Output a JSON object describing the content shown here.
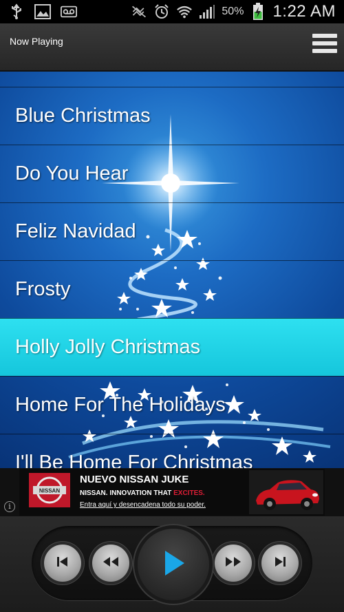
{
  "status_bar": {
    "battery_percent": "50%",
    "time": "1:22 AM",
    "icons": [
      "usb-icon",
      "image-icon",
      "voicemail-icon",
      "mute-icon",
      "alarm-icon",
      "wifi-icon",
      "signal-icon",
      "battery-charging-icon"
    ]
  },
  "header": {
    "title": "Now Playing",
    "menu_icon": "hamburger-menu-icon"
  },
  "songs": [
    {
      "title": "Blue Christmas",
      "selected": false
    },
    {
      "title": "Do You Hear",
      "selected": false
    },
    {
      "title": "Feliz Navidad",
      "selected": false
    },
    {
      "title": "Frosty",
      "selected": false
    },
    {
      "title": "Holly Jolly Christmas",
      "selected": true
    },
    {
      "title": "Home For The Holidays",
      "selected": false
    },
    {
      "title": "I'll Be Home For Christmas",
      "selected": false
    }
  ],
  "ad": {
    "headline": "NUEVO NISSAN JUKE",
    "tagline": "NISSAN. INNOVATION THAT",
    "tagline_highlight": "EXCITES.",
    "cta": "Entra aquí y desencadena todo su poder.",
    "logo_text": "NISSAN",
    "info_icon": "info-icon"
  },
  "controls": {
    "buttons": [
      "skip-previous-icon",
      "rewind-icon",
      "play-icon",
      "fast-forward-icon",
      "skip-next-icon"
    ],
    "accent_color": "#1aa7e8"
  },
  "colors": {
    "selected_row": "#1ed0e4",
    "list_background": "#0e4a9c"
  }
}
